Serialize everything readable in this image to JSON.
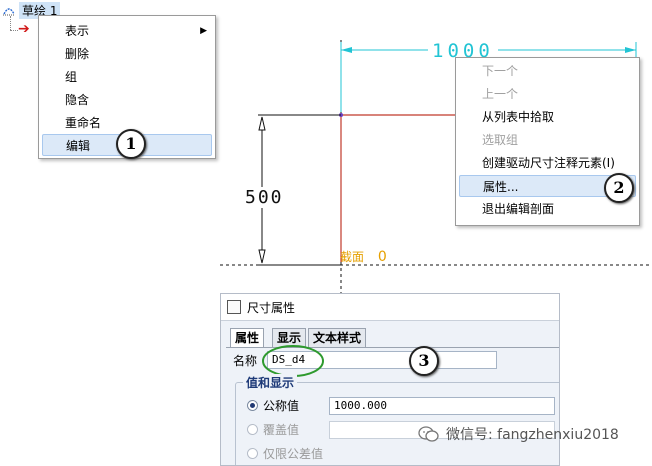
{
  "tree": {
    "sketch_label": "草绘 1"
  },
  "context_menu_1": {
    "items": [
      {
        "label": "表示"
      },
      {
        "label": "删除"
      },
      {
        "label": "组"
      },
      {
        "label": "隐含"
      },
      {
        "label": "重命名"
      },
      {
        "label": "编辑"
      }
    ],
    "badge": "1"
  },
  "context_menu_2": {
    "items": [
      {
        "label": "下一个"
      },
      {
        "label": "上一个"
      },
      {
        "label": "从列表中拾取"
      },
      {
        "label": "选取组"
      },
      {
        "label": "创建驱动尺寸注释元素(I)"
      },
      {
        "label": "属性..."
      },
      {
        "label": "退出编辑剖面"
      }
    ],
    "badge": "2"
  },
  "sketch": {
    "dim_horizontal": "1000",
    "dim_vertical": "500",
    "section_label": "截面",
    "section_value": "0"
  },
  "dialog": {
    "title": "尺寸属性",
    "tabs": [
      {
        "label": "属性"
      },
      {
        "label": "显示"
      },
      {
        "label": "文本样式"
      }
    ],
    "name_label": "名称",
    "name_value": "DS_d4",
    "badge": "3",
    "group_title": "值和显示",
    "nominal_label": "公称值",
    "nominal_value": "1000.000",
    "override_label": "覆盖值",
    "tolerance_label": "仅限公差值"
  },
  "watermark": {
    "text": "微信号: fangzhenxiu2018"
  },
  "colors": {
    "dimension_cyan": "#22c4d4",
    "sketch_red": "#c0392b",
    "section_orange": "#e6a000",
    "highlight_blue": "#dce9f8",
    "ellipse_green": "#2e9a2e"
  }
}
